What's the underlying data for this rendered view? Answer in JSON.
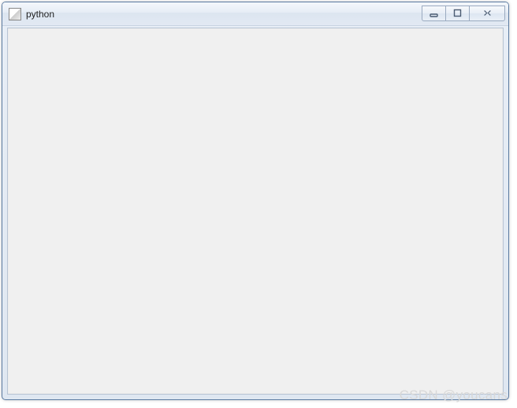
{
  "window": {
    "title": "python",
    "controls": {
      "minimize": "minimize",
      "maximize": "maximize",
      "close": "close"
    }
  },
  "watermark": "CSDN @youcans"
}
